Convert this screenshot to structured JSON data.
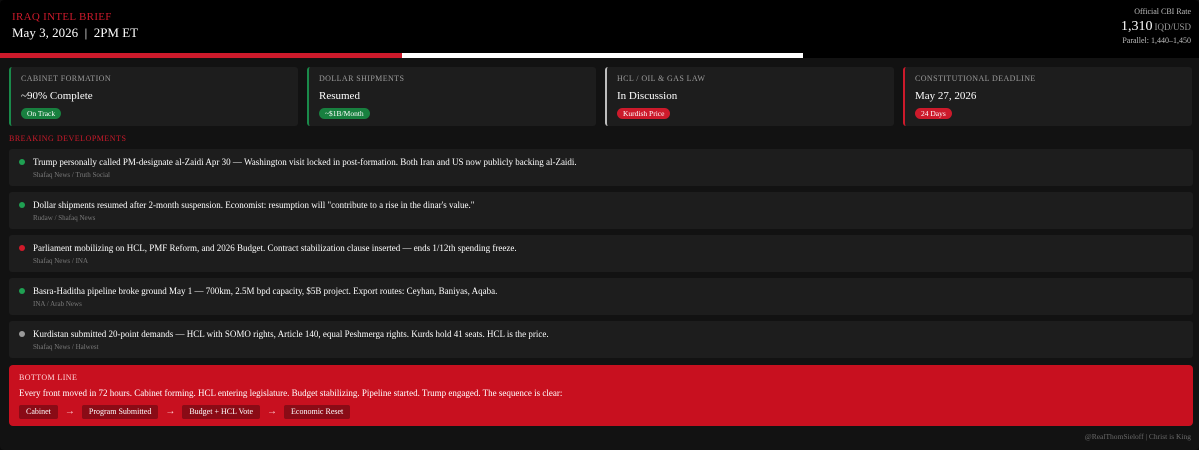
{
  "header": {
    "title": "IRAQ INTEL BRIEF",
    "date": "May 3, 2026",
    "time": "2PM ET",
    "rate_label": "Official CBI Rate",
    "rate_value": "1,310",
    "rate_unit": "IQD/USD",
    "rate_parallel": "Parallel: 1,440–1,450"
  },
  "progress": {
    "percent": 50,
    "fill_color": "#cc1a2b",
    "track_color": "#ffffff"
  },
  "cards": [
    {
      "label": "CABINET FORMATION",
      "value": "~90% Complete",
      "badge": "On Track",
      "accent": "#1a8a4a",
      "badge_color": "#18803f"
    },
    {
      "label": "DOLLAR SHIPMENTS",
      "value": "Resumed",
      "badge": "~$1B/Month",
      "accent": "#1a8a4a",
      "badge_color": "#18803f"
    },
    {
      "label": "HCL / OIL & GAS LAW",
      "value": "In Discussion",
      "badge": "Kurdish Price",
      "accent": "#bdbdbd",
      "badge_color": "#cc1a2b"
    },
    {
      "label": "CONSTITUTIONAL DEADLINE",
      "value": "May 27, 2026",
      "badge": "24 Days",
      "accent": "#cc1a2b",
      "badge_color": "#cc1a2b"
    }
  ],
  "breaking": {
    "title": "BREAKING DEVELOPMENTS",
    "items": [
      {
        "text": "Trump personally called PM-designate al-Zaidi Apr 30 — Washington visit locked in post-formation. Both Iran and US now publicly backing al-Zaidi.",
        "source": "Shafaq News / Truth Social",
        "dot_color": "#1fa052"
      },
      {
        "text": "Dollar shipments resumed after 2-month suspension. Economist: resumption will \"contribute to a rise in the dinar's value.\"",
        "source": "Rudaw / Shafaq News",
        "dot_color": "#1fa052"
      },
      {
        "text": "Parliament mobilizing on HCL, PMF Reform, and 2026 Budget. Contract stabilization clause inserted — ends 1/12th spending freeze.",
        "source": "Shafaq News / INA",
        "dot_color": "#d11a2a"
      },
      {
        "text": "Basra-Haditha pipeline broke ground May 1 — 700km, 2.5M bpd capacity, $5B project. Export routes: Ceyhan, Baniyas, Aqaba.",
        "source": "INA / Arab News",
        "dot_color": "#1fa052"
      },
      {
        "text": "Kurdistan submitted 20-point demands — HCL with SOMO rights, Article 140, equal Peshmerga rights. Kurds hold 41 seats. HCL is the price.",
        "source": "Shafaq News / Halwest",
        "dot_color": "#9a9a9a"
      }
    ]
  },
  "bottom_line": {
    "label": "BOTTOM LINE",
    "text": "Every front moved in 72 hours. Cabinet forming. HCL entering legislature. Budget stabilizing. Pipeline started. Trump engaged. The sequence is clear:",
    "steps": [
      "Cabinet",
      "Program Submitted",
      "Budget + HCL Vote",
      "Economic Reset"
    ],
    "arrow": "→"
  },
  "footer": {
    "handle": "@RealThomSieloff",
    "separator": "|",
    "tagline": "Christ is King"
  }
}
